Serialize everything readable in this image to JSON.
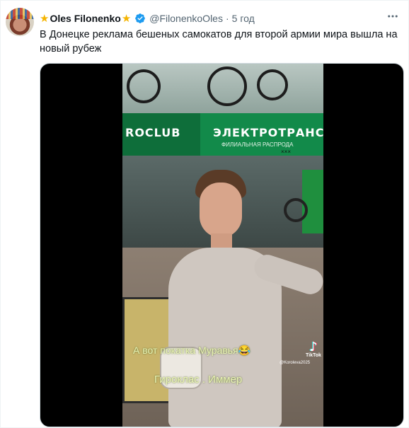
{
  "tweet": {
    "author": {
      "display_name": "Oles Filonenko",
      "handle": "@FilonenkoOles",
      "separator": "·",
      "time": "5 год",
      "verified": true,
      "name_decoration": "star-emoji"
    },
    "text": "В Донецке реклама бешеных самокатов для второй армии мира вышла на новый рубеж",
    "more_icon": "ellipsis-horizontal-icon"
  },
  "media": {
    "type": "video",
    "store_sign_left": "ROCLUB",
    "store_sign_right": "ЭЛЕКТРОТРАНС",
    "store_sign_sub": "ФИЛИАЛЬНАЯ РАСПРОДА",
    "store_sign_marks": "×××",
    "caption_line1": "А вот покатка Муравья😂",
    "caption_line2": "Гироклас . Иммер",
    "tiktok_label": "TikTok",
    "tiktok_user": "@Koroleva2025",
    "colors": {
      "banner_green": "#128a4a",
      "caption_yellow": "#e9f3b4"
    }
  }
}
